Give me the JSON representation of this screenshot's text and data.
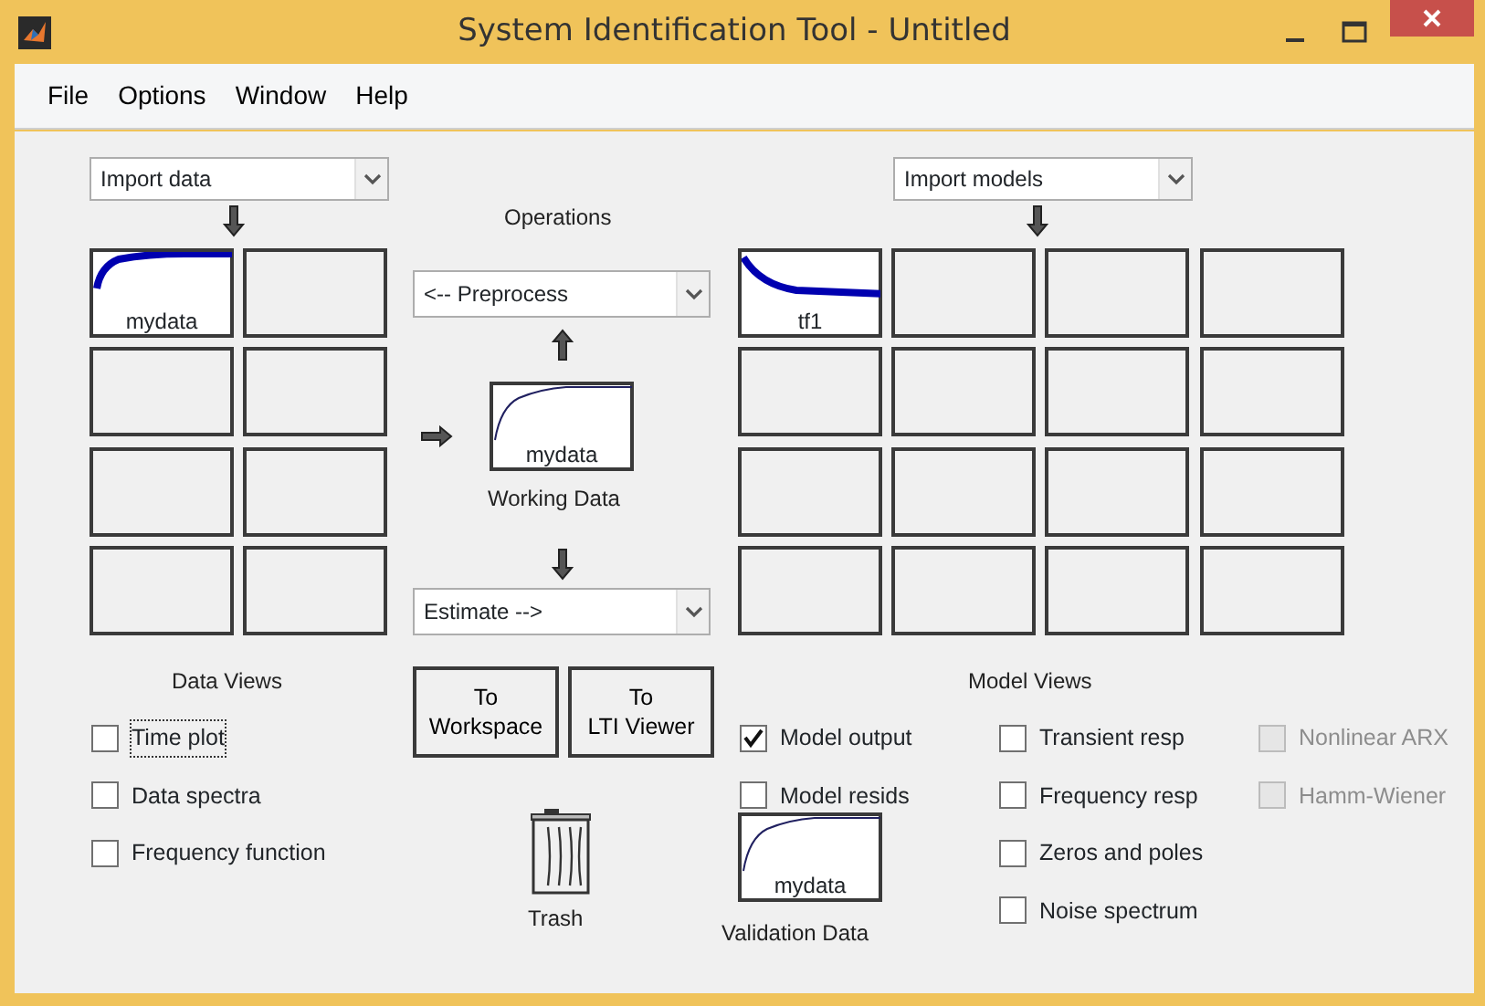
{
  "window": {
    "title": "System Identification Tool - Untitled"
  },
  "menu": [
    "File",
    "Options",
    "Window",
    "Help"
  ],
  "data_import": {
    "value": "Import data"
  },
  "model_import": {
    "value": "Import models"
  },
  "operations_label": "Operations",
  "preprocess": {
    "value": "<-- Preprocess"
  },
  "estimate": {
    "value": "Estimate -->"
  },
  "working_data": {
    "label": "mydata",
    "caption": "Working Data"
  },
  "data_tiles": [
    {
      "kind": "data",
      "label": "mydata"
    },
    {
      "kind": "empty"
    },
    {
      "kind": "empty"
    },
    {
      "kind": "empty"
    },
    {
      "kind": "empty"
    },
    {
      "kind": "empty"
    },
    {
      "kind": "empty"
    },
    {
      "kind": "empty"
    }
  ],
  "model_tiles": [
    {
      "kind": "model",
      "label": "tf1"
    },
    {
      "kind": "empty"
    },
    {
      "kind": "empty"
    },
    {
      "kind": "empty"
    },
    {
      "kind": "empty"
    },
    {
      "kind": "empty"
    },
    {
      "kind": "empty"
    },
    {
      "kind": "empty"
    },
    {
      "kind": "empty"
    },
    {
      "kind": "empty"
    },
    {
      "kind": "empty"
    },
    {
      "kind": "empty"
    },
    {
      "kind": "empty"
    },
    {
      "kind": "empty"
    },
    {
      "kind": "empty"
    },
    {
      "kind": "empty"
    }
  ],
  "data_views": {
    "title": "Data Views",
    "options": [
      {
        "label": "Time plot",
        "checked": false,
        "disabled": false,
        "focused": true
      },
      {
        "label": "Data spectra",
        "checked": false,
        "disabled": false,
        "focused": false
      },
      {
        "label": "Frequency function",
        "checked": false,
        "disabled": false,
        "focused": false
      }
    ]
  },
  "buttons": [
    {
      "line1": "To",
      "line2": "Workspace"
    },
    {
      "line1": "To",
      "line2": "LTI Viewer"
    }
  ],
  "trash_label": "Trash",
  "model_views": {
    "title": "Model Views",
    "columns": [
      [
        {
          "label": "Model output",
          "checked": true,
          "disabled": false
        },
        {
          "label": "Model resids",
          "checked": false,
          "disabled": false
        }
      ],
      [
        {
          "label": "Transient resp",
          "checked": false,
          "disabled": false
        },
        {
          "label": "Frequency resp",
          "checked": false,
          "disabled": false
        },
        {
          "label": "Zeros and poles",
          "checked": false,
          "disabled": false
        },
        {
          "label": "Noise spectrum",
          "checked": false,
          "disabled": false
        }
      ],
      [
        {
          "label": "Nonlinear ARX",
          "checked": false,
          "disabled": true
        },
        {
          "label": "Hamm-Wiener",
          "checked": false,
          "disabled": true
        }
      ]
    ]
  },
  "validation_data": {
    "label": "mydata",
    "caption": "Validation Data"
  }
}
